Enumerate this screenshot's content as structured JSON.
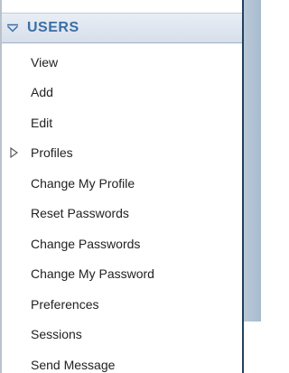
{
  "section": {
    "title": "USERS",
    "expanded": true
  },
  "menu": {
    "items": [
      {
        "label": "View"
      },
      {
        "label": "Add"
      },
      {
        "label": "Edit"
      },
      {
        "label": "Profiles",
        "has_children": true
      },
      {
        "label": "Change My Profile"
      },
      {
        "label": "Reset Passwords"
      },
      {
        "label": "Change Passwords"
      },
      {
        "label": "Change My Password"
      },
      {
        "label": "Preferences"
      },
      {
        "label": "Sessions"
      },
      {
        "label": "Send Message"
      }
    ]
  },
  "colors": {
    "header_text": "#3a6ea5",
    "header_bg": "#dde5ee",
    "item_text": "#222222",
    "pane_edge": "#24415c"
  },
  "icons": {
    "header": "chevron-down-icon",
    "profiles": "caret-right-icon"
  }
}
